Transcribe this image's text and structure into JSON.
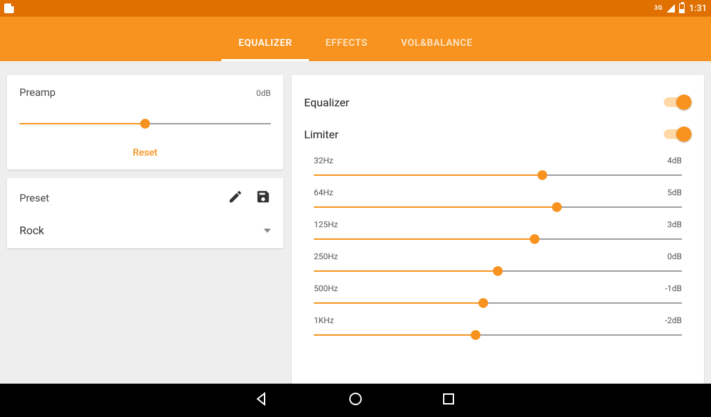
{
  "status": {
    "network": "3G",
    "clock": "1:31"
  },
  "tabs": {
    "equalizer": "EQUALIZER",
    "effects": "EFFECTS",
    "volbalance": "VOL&BALANCE",
    "active": 0
  },
  "preamp": {
    "label": "Preamp",
    "value_label": "0dB",
    "fill_pct": 50,
    "reset": "Reset"
  },
  "preset": {
    "label": "Preset",
    "value": "Rock"
  },
  "toggles": {
    "equalizer_label": "Equalizer",
    "equalizer_on": true,
    "limiter_label": "Limiter",
    "limiter_on": true
  },
  "bands": [
    {
      "freq": "32Hz",
      "gain": "4dB",
      "fill_pct": 62
    },
    {
      "freq": "64Hz",
      "gain": "5dB",
      "fill_pct": 66
    },
    {
      "freq": "125Hz",
      "gain": "3dB",
      "fill_pct": 60
    },
    {
      "freq": "250Hz",
      "gain": "0dB",
      "fill_pct": 50
    },
    {
      "freq": "500Hz",
      "gain": "-1dB",
      "fill_pct": 46
    },
    {
      "freq": "1KHz",
      "gain": "-2dB",
      "fill_pct": 44
    }
  ]
}
